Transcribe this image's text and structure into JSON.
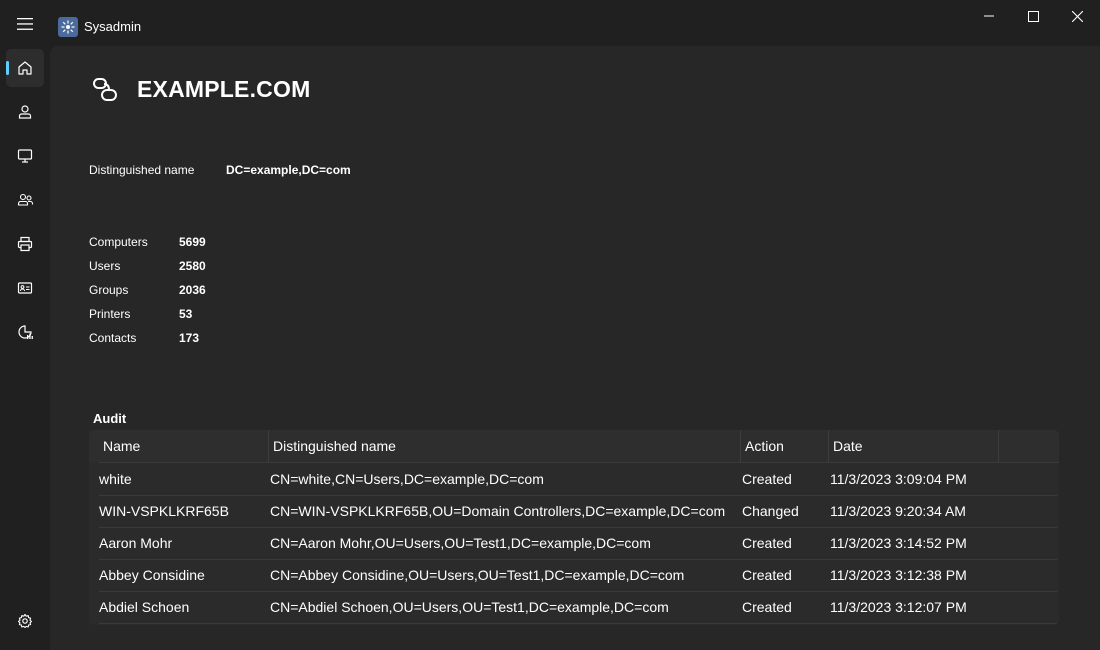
{
  "app": {
    "title": "Sysadmin",
    "accent": "#60cdff"
  },
  "sidebar": {
    "items": [
      {
        "icon": "home-icon",
        "active": true
      },
      {
        "icon": "user-icon",
        "active": false
      },
      {
        "icon": "computer-icon",
        "active": false
      },
      {
        "icon": "groups-icon",
        "active": false
      },
      {
        "icon": "printer-icon",
        "active": false
      },
      {
        "icon": "contact-card-icon",
        "active": false
      },
      {
        "icon": "report-icon",
        "active": false
      }
    ],
    "settings_icon": "gear-icon"
  },
  "domain": {
    "name": "EXAMPLE.COM",
    "dn_label": "Distinguished name",
    "dn_value": "DC=example,DC=com"
  },
  "stats": [
    {
      "label": "Computers",
      "value": "5699"
    },
    {
      "label": "Users",
      "value": "2580"
    },
    {
      "label": "Groups",
      "value": "2036"
    },
    {
      "label": "Printers",
      "value": "53"
    },
    {
      "label": "Contacts",
      "value": "173"
    }
  ],
  "audit": {
    "heading": "Audit",
    "columns": [
      "Name",
      "Distinguished name",
      "Action",
      "Date"
    ],
    "rows": [
      {
        "name": "white",
        "dn": "CN=white,CN=Users,DC=example,DC=com",
        "action": "Created",
        "date": "11/3/2023 3:09:04 PM"
      },
      {
        "name": "WIN-VSPKLKRF65B",
        "dn": "CN=WIN-VSPKLKRF65B,OU=Domain Controllers,DC=example,DC=com",
        "action": "Changed",
        "date": "11/3/2023 9:20:34 AM"
      },
      {
        "name": "Aaron Mohr",
        "dn": "CN=Aaron Mohr,OU=Users,OU=Test1,DC=example,DC=com",
        "action": "Created",
        "date": "11/3/2023 3:14:52 PM"
      },
      {
        "name": "Abbey Considine",
        "dn": "CN=Abbey Considine,OU=Users,OU=Test1,DC=example,DC=com",
        "action": "Created",
        "date": "11/3/2023 3:12:38 PM"
      },
      {
        "name": "Abdiel Schoen",
        "dn": "CN=Abdiel Schoen,OU=Users,OU=Test1,DC=example,DC=com",
        "action": "Created",
        "date": "11/3/2023 3:12:07 PM"
      }
    ]
  }
}
